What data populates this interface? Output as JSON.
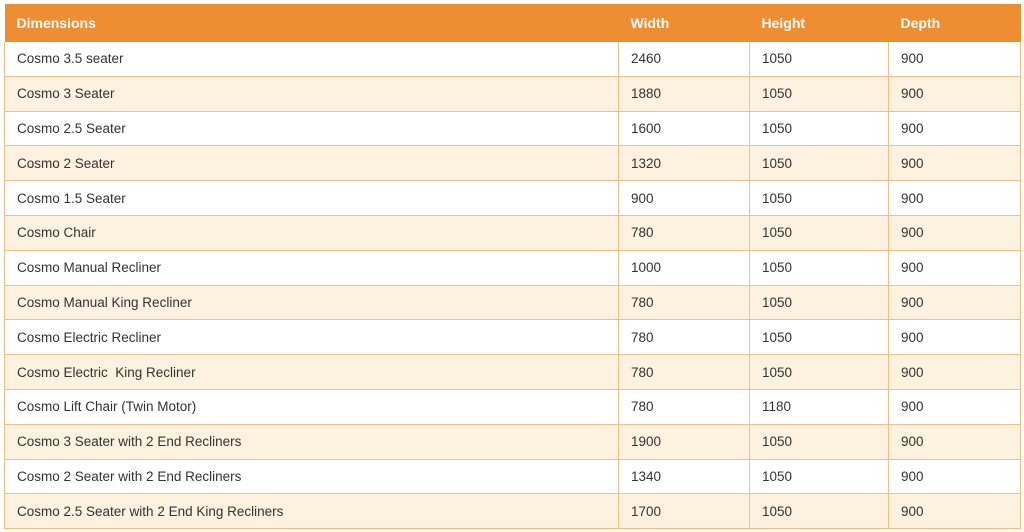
{
  "table": {
    "headers": [
      "Dimensions",
      "Width",
      "Height",
      "Depth"
    ],
    "rows": [
      [
        "Cosmo 3.5 seater",
        "2460",
        "1050",
        "900"
      ],
      [
        "Cosmo 3 Seater",
        "1880",
        "1050",
        "900"
      ],
      [
        "Cosmo 2.5 Seater",
        "1600",
        "1050",
        "900"
      ],
      [
        "Cosmo 2 Seater",
        "1320",
        "1050",
        "900"
      ],
      [
        "Cosmo 1.5 Seater",
        "900",
        "1050",
        "900"
      ],
      [
        "Cosmo Chair",
        "780",
        "1050",
        "900"
      ],
      [
        "Cosmo Manual Recliner",
        "1000",
        "1050",
        "900"
      ],
      [
        "Cosmo Manual King Recliner",
        "780",
        "1050",
        "900"
      ],
      [
        "Cosmo Electric Recliner",
        "780",
        "1050",
        "900"
      ],
      [
        "Cosmo Electric  King Recliner",
        "780",
        "1050",
        "900"
      ],
      [
        "Cosmo Lift Chair (Twin Motor)",
        "780",
        "1180",
        "900"
      ],
      [
        "Cosmo 3 Seater with 2 End Recliners",
        "1900",
        "1050",
        "900"
      ],
      [
        "Cosmo 2 Seater with 2 End Recliners",
        "1340",
        "1050",
        "900"
      ],
      [
        "Cosmo 2.5 Seater with 2 End King Recliners",
        "1700",
        "1050",
        "900"
      ]
    ]
  },
  "colors": {
    "header_bg": "#ee8e33",
    "header_text": "#ffffff",
    "row_alt_bg": "#fdf1df",
    "border": "#f0c08c"
  }
}
